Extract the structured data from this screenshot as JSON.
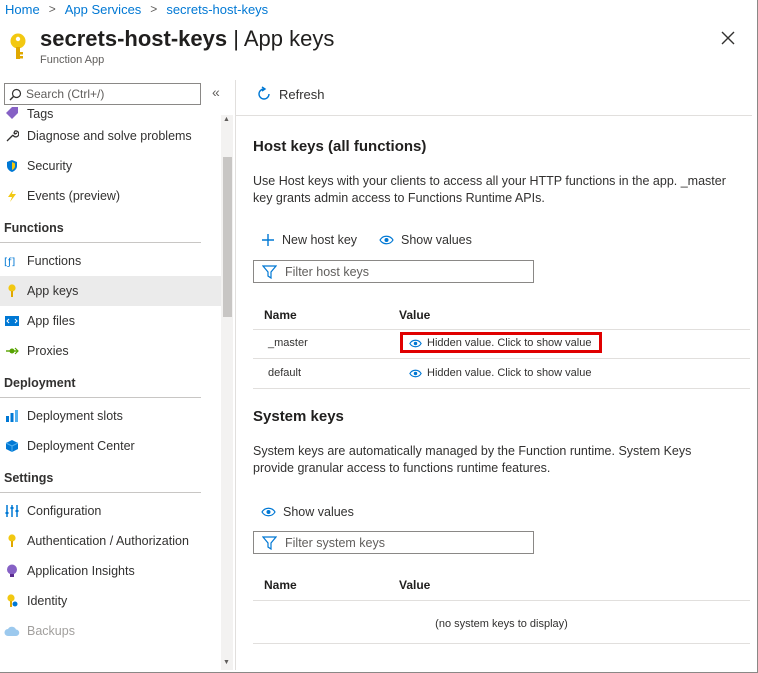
{
  "breadcrumb": [
    "Home",
    "App Services",
    "secrets-host-keys"
  ],
  "header": {
    "name": "secrets-host-keys",
    "separator": " | ",
    "page": "App keys",
    "subtitle": "Function App"
  },
  "sidebar": {
    "search_placeholder": "Search (Ctrl+/)",
    "collapse": "«",
    "items_top": [
      {
        "label": "Tags"
      },
      {
        "label": "Diagnose and solve problems"
      },
      {
        "label": "Security"
      },
      {
        "label": "Events (preview)"
      }
    ],
    "sections": [
      {
        "title": "Functions",
        "items": [
          "Functions",
          "App keys",
          "App files",
          "Proxies"
        ]
      },
      {
        "title": "Deployment",
        "items": [
          "Deployment slots",
          "Deployment Center"
        ]
      },
      {
        "title": "Settings",
        "items": [
          "Configuration",
          "Authentication / Authorization",
          "Application Insights",
          "Identity",
          "Backups"
        ]
      }
    ]
  },
  "toolbar": {
    "refresh": "Refresh"
  },
  "host_keys": {
    "title": "Host keys (all functions)",
    "description": "Use Host keys with your clients to access all your HTTP functions in the app. _master key grants admin access to Functions Runtime APIs.",
    "new_key": "New host key",
    "show_values": "Show values",
    "filter_placeholder": "Filter host keys",
    "col_name": "Name",
    "col_value": "Value",
    "rows": [
      {
        "name": "_master",
        "value": "Hidden value. Click to show value"
      },
      {
        "name": "default",
        "value": "Hidden value. Click to show value"
      }
    ]
  },
  "system_keys": {
    "title": "System keys",
    "description": "System keys are automatically managed by the Function runtime. System Keys provide granular access to functions runtime features.",
    "show_values": "Show values",
    "filter_placeholder": "Filter system keys",
    "col_name": "Name",
    "col_value": "Value",
    "empty": "(no system keys to display)"
  },
  "colors": {
    "accent": "#0078d4",
    "highlight": "#e00000",
    "key": "#f2c811"
  }
}
